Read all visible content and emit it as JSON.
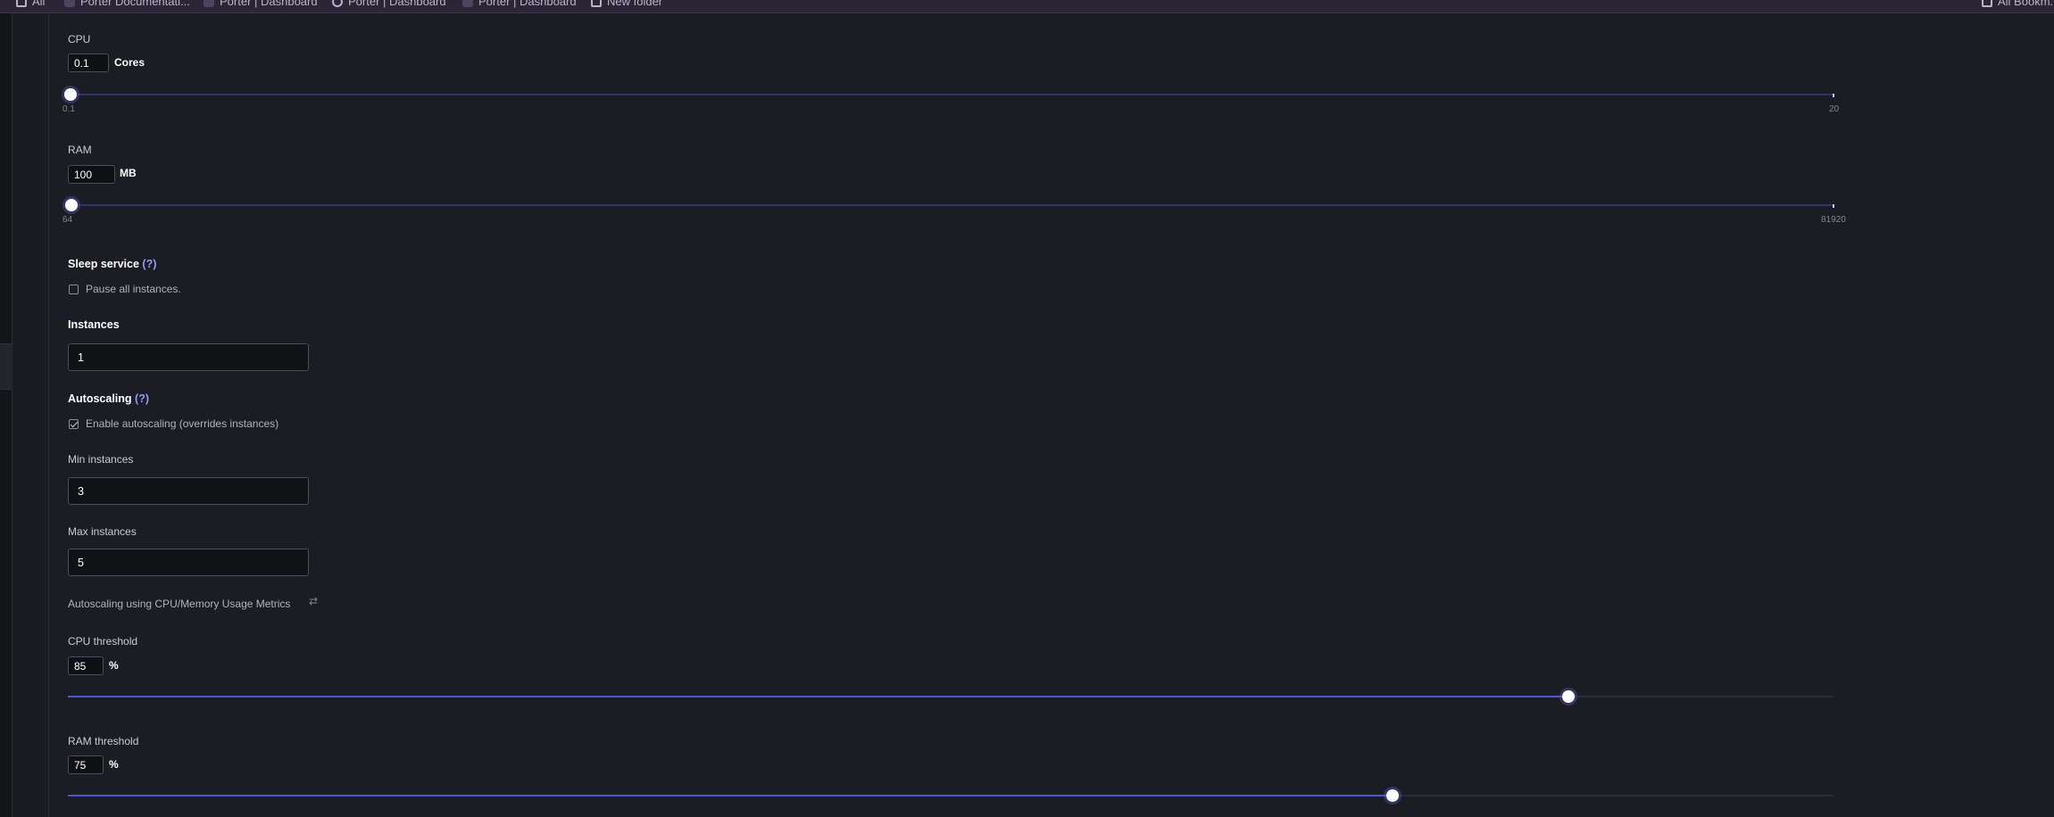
{
  "bookmarks": [
    {
      "label": "All",
      "icon": "folder-icon"
    },
    {
      "label": "Porter Documentati...",
      "icon": "porter-icon"
    },
    {
      "label": "Porter | Dashboard",
      "icon": "porter-icon"
    },
    {
      "label": "Porter | Dashboard",
      "icon": "globe-icon"
    },
    {
      "label": "Porter | Dashboard",
      "icon": "porter-icon"
    },
    {
      "label": "New folder",
      "icon": "folder-icon"
    },
    {
      "label": "All Bookm...",
      "icon": "folder-icon"
    }
  ],
  "cpu": {
    "label": "CPU",
    "value": "0.1",
    "unit": "Cores",
    "min_label": "0.1",
    "max_label": "20",
    "min": 0.1,
    "max": 20,
    "current": 0.1
  },
  "ram": {
    "label": "RAM",
    "value": "100",
    "unit": "MB",
    "min_label": "64",
    "max_label": "81920",
    "min": 64,
    "max": 81920,
    "current": 100
  },
  "sleep": {
    "title": "Sleep service",
    "help": "(?)",
    "checkbox_label": "Pause all instances.",
    "checked": false
  },
  "instances": {
    "label": "Instances",
    "value": "1"
  },
  "autoscaling": {
    "title": "Autoscaling",
    "help": "(?)",
    "checkbox_label": "Enable autoscaling (overrides instances)",
    "checked": true
  },
  "min_instances": {
    "label": "Min instances",
    "value": "3"
  },
  "max_instances": {
    "label": "Max instances",
    "value": "5"
  },
  "metrics_note": "Autoscaling using CPU/Memory Usage Metrics",
  "cpu_threshold": {
    "label": "CPU threshold",
    "value": "85",
    "unit": "%",
    "percent": 85
  },
  "ram_threshold": {
    "label": "RAM threshold",
    "value": "75",
    "unit": "%",
    "percent": 75
  },
  "colors": {
    "accent": "#4a58d6",
    "help_link": "#8f9cff",
    "background": "#1b1d22"
  }
}
